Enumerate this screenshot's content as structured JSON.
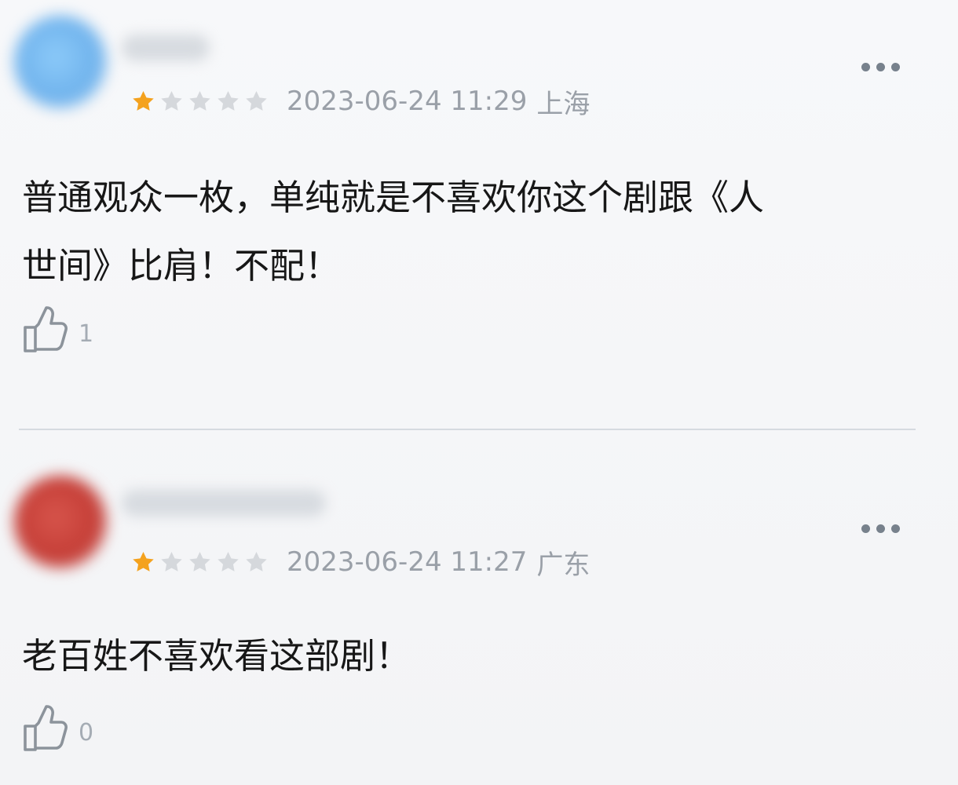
{
  "comments": [
    {
      "avatar_color": "#71b6ef",
      "rating": {
        "filled": 1,
        "total": 5
      },
      "timestamp": "2023-06-24 11:29",
      "location": "上海",
      "text": "普通观众一枚，单纯就是不喜欢你这个剧跟《人\n世间》比肩！不配！",
      "like_count": "1",
      "icons": {
        "more": "more-dots-icon",
        "like": "thumbs-up-icon",
        "star_filled": "star-filled-icon",
        "star_empty": "star-empty-icon"
      }
    },
    {
      "avatar_color": "#c94740",
      "rating": {
        "filled": 1,
        "total": 5
      },
      "timestamp": "2023-06-24 11:27",
      "location": "广东",
      "text": "老百姓不喜欢看这部剧！",
      "like_count": "0",
      "icons": {
        "more": "more-dots-icon",
        "like": "thumbs-up-icon",
        "star_filled": "star-filled-icon",
        "star_empty": "star-empty-icon"
      }
    }
  ],
  "colors": {
    "star_filled": "#f4a21e",
    "star_empty": "#d5d8dc",
    "meta_text": "#9aa0a8",
    "divider": "#d6dae0"
  }
}
